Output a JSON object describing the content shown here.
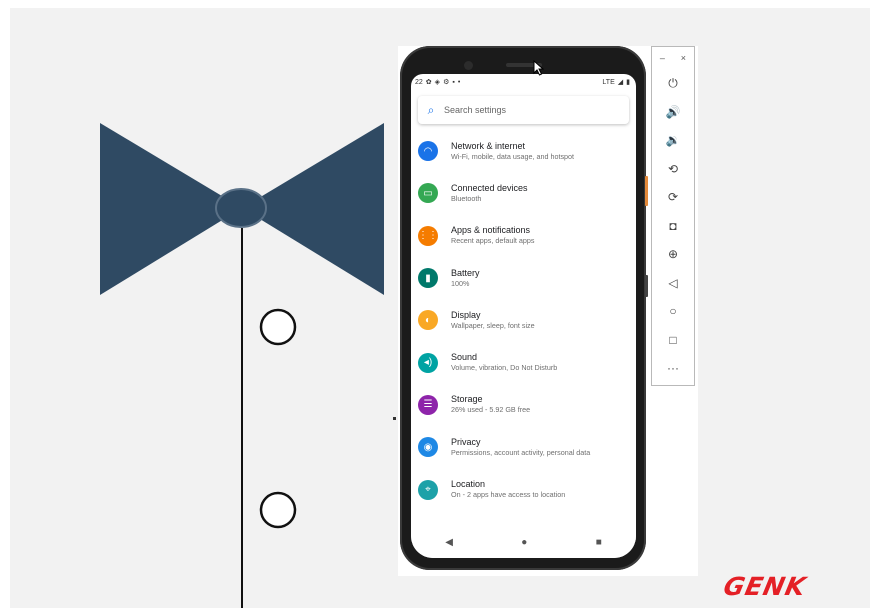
{
  "phone": {
    "status": {
      "time": "22",
      "network": "LTE"
    },
    "search": {
      "placeholder": "Search settings"
    },
    "settings": [
      {
        "title": "Network & internet",
        "subtitle": "Wi-Fi, mobile, data usage, and hotspot",
        "icon": "wifi-icon",
        "color": "#1a73e8",
        "glyph": "◠"
      },
      {
        "title": "Connected devices",
        "subtitle": "Bluetooth",
        "icon": "connected-devices-icon",
        "color": "#34a853",
        "glyph": "▭"
      },
      {
        "title": "Apps & notifications",
        "subtitle": "Recent apps, default apps",
        "icon": "apps-icon",
        "color": "#f57c00",
        "glyph": "⋮⋮"
      },
      {
        "title": "Battery",
        "subtitle": "100%",
        "icon": "battery-icon",
        "color": "#00796b",
        "glyph": "▮"
      },
      {
        "title": "Display",
        "subtitle": "Wallpaper, sleep, font size",
        "icon": "display-icon",
        "color": "#f9a825",
        "glyph": "◐"
      },
      {
        "title": "Sound",
        "subtitle": "Volume, vibration, Do Not Disturb",
        "icon": "sound-icon",
        "color": "#00a3a3",
        "glyph": "◂)"
      },
      {
        "title": "Storage",
        "subtitle": "26% used - 5.92 GB free",
        "icon": "storage-icon",
        "color": "#8e24aa",
        "glyph": "☰"
      },
      {
        "title": "Privacy",
        "subtitle": "Permissions, account activity, personal data",
        "icon": "privacy-icon",
        "color": "#1e88e5",
        "glyph": "◉"
      },
      {
        "title": "Location",
        "subtitle": "On - 2 apps have access to location",
        "icon": "location-icon",
        "color": "#1da1a8",
        "glyph": "⌖"
      }
    ]
  },
  "toolbar": {
    "window_minimize": "–",
    "window_close": "×",
    "buttons": [
      {
        "name": "power-icon",
        "glyph": "⏻"
      },
      {
        "name": "volume-up-icon",
        "glyph": "🔊"
      },
      {
        "name": "volume-down-icon",
        "glyph": "🔉"
      },
      {
        "name": "rotate-left-icon",
        "glyph": "⟲"
      },
      {
        "name": "rotate-right-icon",
        "glyph": "⟳"
      },
      {
        "name": "camera-icon",
        "glyph": "◘"
      },
      {
        "name": "zoom-icon",
        "glyph": "⊕"
      },
      {
        "name": "back-icon",
        "glyph": "◁"
      },
      {
        "name": "home-icon",
        "glyph": "○"
      },
      {
        "name": "overview-icon",
        "glyph": "□"
      },
      {
        "name": "more-icon",
        "glyph": "···"
      }
    ]
  },
  "logo": {
    "text": "GENK"
  },
  "colors": {
    "bowtie": "#2f4a63",
    "accent": "#1a73e8",
    "logo": "#e42026"
  }
}
